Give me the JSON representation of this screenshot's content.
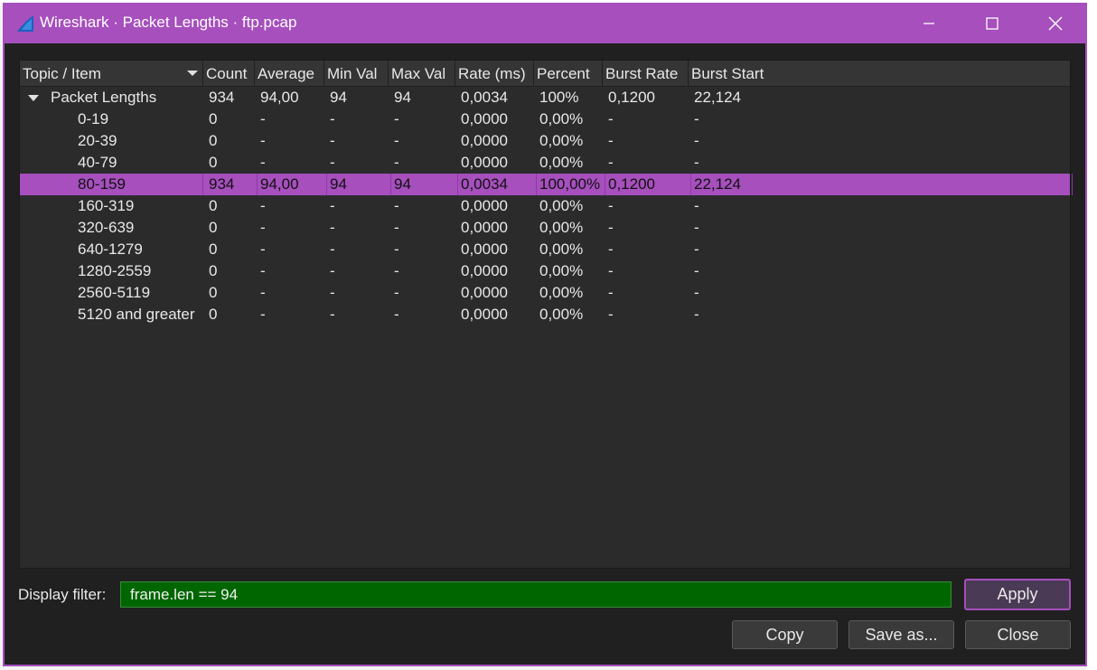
{
  "window": {
    "title": "Wireshark · Packet Lengths · ftp.pcap",
    "accent": "#a64fbd"
  },
  "columns": [
    "Topic / Item",
    "Count",
    "Average",
    "Min Val",
    "Max Val",
    "Rate (ms)",
    "Percent",
    "Burst Rate",
    "Burst Start"
  ],
  "rows": [
    {
      "label": "Packet Lengths",
      "count": "934",
      "average": "94,00",
      "min": "94",
      "max": "94",
      "rate": "0,0034",
      "percent": "100%",
      "burst_rate": "0,1200",
      "burst_start": "22,124"
    },
    {
      "label": "0-19",
      "count": "0",
      "average": "-",
      "min": "-",
      "max": "-",
      "rate": "0,0000",
      "percent": "0,00%",
      "burst_rate": "-",
      "burst_start": "-"
    },
    {
      "label": "20-39",
      "count": "0",
      "average": "-",
      "min": "-",
      "max": "-",
      "rate": "0,0000",
      "percent": "0,00%",
      "burst_rate": "-",
      "burst_start": "-"
    },
    {
      "label": "40-79",
      "count": "0",
      "average": "-",
      "min": "-",
      "max": "-",
      "rate": "0,0000",
      "percent": "0,00%",
      "burst_rate": "-",
      "burst_start": "-"
    },
    {
      "label": "80-159",
      "count": "934",
      "average": "94,00",
      "min": "94",
      "max": "94",
      "rate": "0,0034",
      "percent": "100,00%",
      "burst_rate": "0,1200",
      "burst_start": "22,124"
    },
    {
      "label": "160-319",
      "count": "0",
      "average": "-",
      "min": "-",
      "max": "-",
      "rate": "0,0000",
      "percent": "0,00%",
      "burst_rate": "-",
      "burst_start": "-"
    },
    {
      "label": "320-639",
      "count": "0",
      "average": "-",
      "min": "-",
      "max": "-",
      "rate": "0,0000",
      "percent": "0,00%",
      "burst_rate": "-",
      "burst_start": "-"
    },
    {
      "label": "640-1279",
      "count": "0",
      "average": "-",
      "min": "-",
      "max": "-",
      "rate": "0,0000",
      "percent": "0,00%",
      "burst_rate": "-",
      "burst_start": "-"
    },
    {
      "label": "1280-2559",
      "count": "0",
      "average": "-",
      "min": "-",
      "max": "-",
      "rate": "0,0000",
      "percent": "0,00%",
      "burst_rate": "-",
      "burst_start": "-"
    },
    {
      "label": "2560-5119",
      "count": "0",
      "average": "-",
      "min": "-",
      "max": "-",
      "rate": "0,0000",
      "percent": "0,00%",
      "burst_rate": "-",
      "burst_start": "-"
    },
    {
      "label": "5120 and greater",
      "count": "0",
      "average": "-",
      "min": "-",
      "max": "-",
      "rate": "0,0000",
      "percent": "0,00%",
      "burst_rate": "-",
      "burst_start": "-"
    }
  ],
  "selected_row_index": 4,
  "filter": {
    "label": "Display filter:",
    "value": "frame.len == 94",
    "color": "#006600"
  },
  "buttons": {
    "apply": "Apply",
    "copy": "Copy",
    "save_as": "Save as...",
    "close": "Close"
  },
  "icons": {
    "app": "wireshark-fin-icon",
    "minimize": "minimize-icon",
    "maximize": "maximize-icon",
    "close": "close-icon",
    "sort": "sort-desc-icon",
    "expand": "tree-expanded-icon"
  }
}
